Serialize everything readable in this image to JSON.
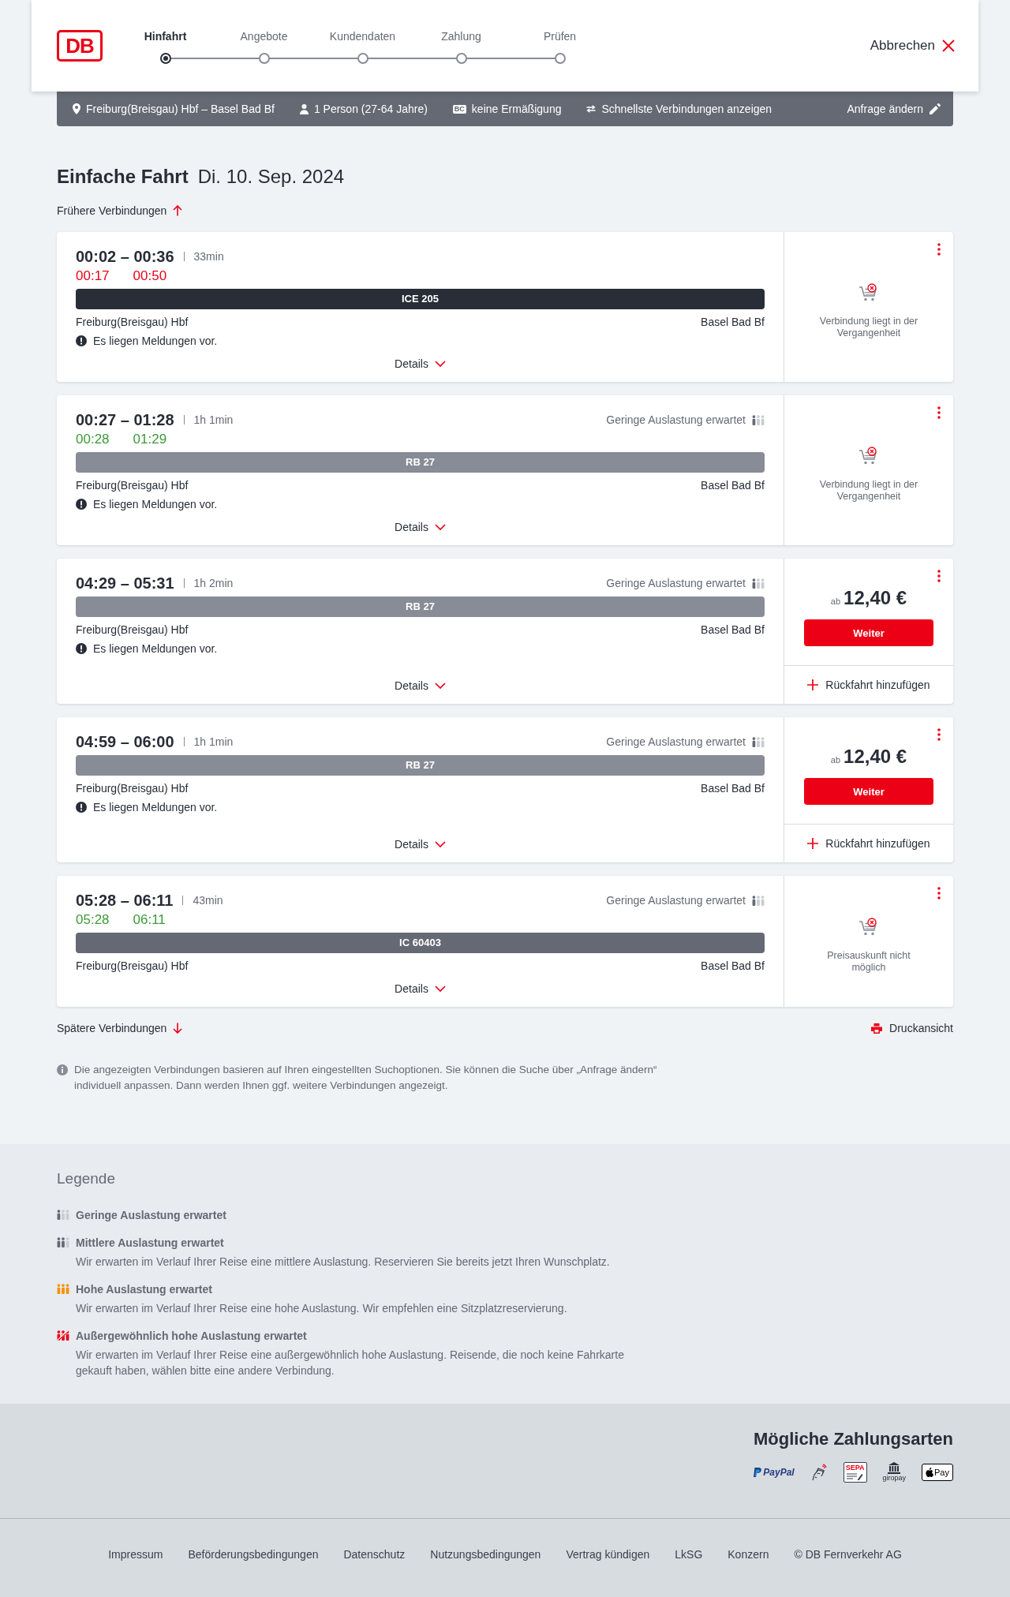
{
  "header": {
    "logo": "DB",
    "steps": [
      {
        "label": "Hinfahrt",
        "selected": true
      },
      {
        "label": "Angebote",
        "selected": false
      },
      {
        "label": "Kundendaten",
        "selected": false
      },
      {
        "label": "Zahlung",
        "selected": false
      },
      {
        "label": "Prüfen",
        "selected": false
      }
    ],
    "cancel": "Abbrechen"
  },
  "summary": {
    "items": [
      {
        "kind": "route",
        "text": "Freiburg(Breisgau) Hbf – Basel Bad Bf"
      },
      {
        "kind": "travellers",
        "text": "1 Person (27-64 Jahre)"
      },
      {
        "kind": "discount",
        "badge": "BC",
        "text": "keine Ermäßigung"
      },
      {
        "kind": "options",
        "text": "Schnellste Verbindungen anzeigen"
      }
    ],
    "edit": "Anfrage ändern"
  },
  "heading": {
    "title": "Einfache Fahrt",
    "date": "Di. 10. Sep. 2024"
  },
  "earlier": "Frühere Verbindungen",
  "connections": [
    {
      "times": "00:02 – 00:36",
      "duration": "33min",
      "realtime": {
        "departure": "00:17",
        "arrival": "00:50",
        "delayed": true
      },
      "train": {
        "name": "ICE 205",
        "color": "#282d37"
      },
      "from": "Freiburg(Breisgau) Hbf",
      "to": "Basel Bad Bf",
      "notice": "Es liegen Meldungen vor.",
      "details": "Details",
      "offer": {
        "kind": "unavailable",
        "message": "Verbindung liegt in der Vergangenheit"
      }
    },
    {
      "times": "00:27 – 01:28",
      "duration": "1h 1min",
      "occupancy": {
        "kind": "low",
        "text": "Geringe Auslastung erwartet"
      },
      "realtime": {
        "departure": "00:28",
        "arrival": "01:29",
        "delayed": false
      },
      "train": {
        "name": "RB 27",
        "color": "#878c96"
      },
      "from": "Freiburg(Breisgau) Hbf",
      "to": "Basel Bad Bf",
      "notice": "Es liegen Meldungen vor.",
      "details": "Details",
      "offer": {
        "kind": "unavailable",
        "message": "Verbindung liegt in der Vergangenheit"
      }
    },
    {
      "times": "04:29 – 05:31",
      "duration": "1h 2min",
      "occupancy": {
        "kind": "low",
        "text": "Geringe Auslastung erwartet"
      },
      "train": {
        "name": "RB 27",
        "color": "#878c96"
      },
      "from": "Freiburg(Breisgau) Hbf",
      "to": "Basel Bad Bf",
      "notice": "Es liegen Meldungen vor.",
      "details": "Details",
      "offer": {
        "kind": "price",
        "prefix": "ab",
        "price": "12,40 €",
        "button": "Weiter",
        "return": "Rückfahrt hinzufügen"
      }
    },
    {
      "times": "04:59 – 06:00",
      "duration": "1h 1min",
      "occupancy": {
        "kind": "low",
        "text": "Geringe Auslastung erwartet"
      },
      "train": {
        "name": "RB 27",
        "color": "#878c96"
      },
      "from": "Freiburg(Breisgau) Hbf",
      "to": "Basel Bad Bf",
      "notice": "Es liegen Meldungen vor.",
      "details": "Details",
      "offer": {
        "kind": "price",
        "prefix": "ab",
        "price": "12,40 €",
        "button": "Weiter",
        "return": "Rückfahrt hinzufügen"
      }
    },
    {
      "times": "05:28 – 06:11",
      "duration": "43min",
      "occupancy": {
        "kind": "low",
        "text": "Geringe Auslastung erwartet"
      },
      "realtime": {
        "departure": "05:28",
        "arrival": "06:11",
        "delayed": false
      },
      "train": {
        "name": "IC 60403",
        "color": "#646973"
      },
      "from": "Freiburg(Breisgau) Hbf",
      "to": "Basel Bad Bf",
      "details": "Details",
      "offer": {
        "kind": "unavailable",
        "message": "Preisauskunft nicht möglich"
      }
    }
  ],
  "later": "Spätere Verbindungen",
  "print": "Druckansicht",
  "info": "Die angezeigten Verbindungen basieren auf Ihren eingestellten Suchoptionen. Sie können die Suche über „Anfrage ändern“ individuell anpassen. Dann werden Ihnen ggf. weitere Verbindungen angezeigt.",
  "legend": {
    "title": "Legende",
    "items": [
      {
        "kind": "low",
        "label": "Geringe Auslastung erwartet"
      },
      {
        "kind": "medium",
        "label": "Mittlere Auslastung erwartet",
        "description": "Wir erwarten im Verlauf Ihrer Reise eine mittlere Auslastung. Reservieren Sie bereits jetzt Ihren Wunschplatz."
      },
      {
        "kind": "high",
        "label": "Hohe Auslastung erwartet",
        "description": "Wir erwarten im Verlauf Ihrer Reise eine hohe Auslastung. Wir empfehlen eine Sitzplatzreservierung."
      },
      {
        "kind": "exceptional",
        "label": "Außergewöhnlich hohe Auslastung erwartet",
        "description": "Wir erwarten im Verlauf Ihrer Reise eine außergewöhnlich hohe Auslastung. Reisende, die noch keine Fahrkarte gekauft haben, wählen bitte eine andere Verbindung."
      }
    ]
  },
  "payment": {
    "title": "Mögliche Zahlungsarten",
    "methods": [
      {
        "kind": "paypal",
        "label": "PayPal"
      },
      {
        "kind": "contactless"
      },
      {
        "kind": "sepa",
        "label": "SEPA"
      },
      {
        "kind": "giropay",
        "label": "giropay"
      },
      {
        "kind": "applepay",
        "label": "Pay"
      }
    ]
  },
  "footer": {
    "links": [
      "Impressum",
      "Beförderungsbedingungen",
      "Datenschutz",
      "Nutzungsbedingungen",
      "Vertrag kündigen",
      "LkSG",
      "Konzern",
      "© DB Fernverkehr AG"
    ]
  }
}
